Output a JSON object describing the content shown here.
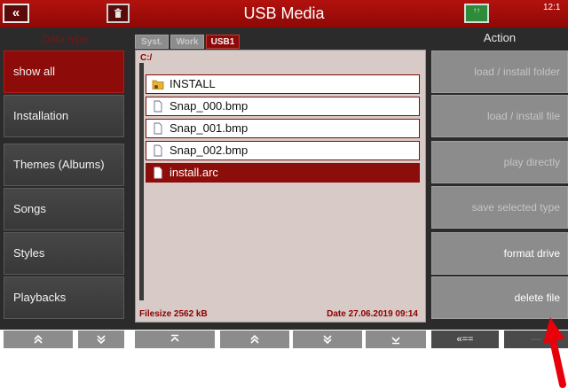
{
  "title": "USB Media",
  "time": "12:1",
  "title_icons": {
    "back": "double-left-icon",
    "trash": "trash-icon",
    "usb": "usb-drive-icon"
  },
  "usb_icon_text": "↑↑",
  "left_header": "Data type",
  "right_header": "Action",
  "data_types": [
    {
      "label": "show all",
      "active": true
    },
    {
      "label": "Installation",
      "active": false
    },
    {
      "label": "Themes (Albums)",
      "active": false
    },
    {
      "label": "Songs",
      "active": false
    },
    {
      "label": "Styles",
      "active": false
    },
    {
      "label": "Playbacks",
      "active": false
    }
  ],
  "tabs": [
    {
      "label": "Syst.",
      "active": false
    },
    {
      "label": "Work",
      "active": false
    },
    {
      "label": "USB1",
      "active": true
    }
  ],
  "path": "C:/",
  "files": [
    {
      "name": "INSTALL",
      "icon": "folder-icon",
      "selected": false
    },
    {
      "name": "Snap_000.bmp",
      "icon": "file-icon",
      "selected": false
    },
    {
      "name": "Snap_001.bmp",
      "icon": "file-icon",
      "selected": false
    },
    {
      "name": "Snap_002.bmp",
      "icon": "file-icon",
      "selected": false
    },
    {
      "name": "install.arc",
      "icon": "file-icon",
      "selected": true
    }
  ],
  "status": {
    "filesize": "Filesize 2562 kB",
    "date": "Date 27.06.2019  09:14"
  },
  "actions": [
    {
      "label": "load  /  install  folder",
      "enabled": false
    },
    {
      "label": "load  /  install  file",
      "enabled": false
    },
    {
      "label": "play  directly",
      "enabled": false
    },
    {
      "label": "save  selected  type",
      "enabled": false
    },
    {
      "label": "format  drive",
      "enabled": true
    },
    {
      "label": "delete  file",
      "enabled": true
    }
  ],
  "bottom_nav": [
    {
      "label": "≈",
      "name": "left-page-up-button"
    },
    {
      "label": "≈",
      "name": "left-page-down-button"
    },
    {
      "label": "⌅",
      "name": "scroll-top-button"
    },
    {
      "label": "≈",
      "name": "scroll-up-button"
    },
    {
      "label": "≈",
      "name": "scroll-down-button"
    },
    {
      "label": "⌄",
      "name": "scroll-bottom-button"
    },
    {
      "label": "«==",
      "name": "back-action-button"
    },
    {
      "label": "---",
      "name": "next-action-button"
    }
  ],
  "colors": {
    "accent_red": "#8d0c0a",
    "annotation_red": "#e8000b"
  }
}
